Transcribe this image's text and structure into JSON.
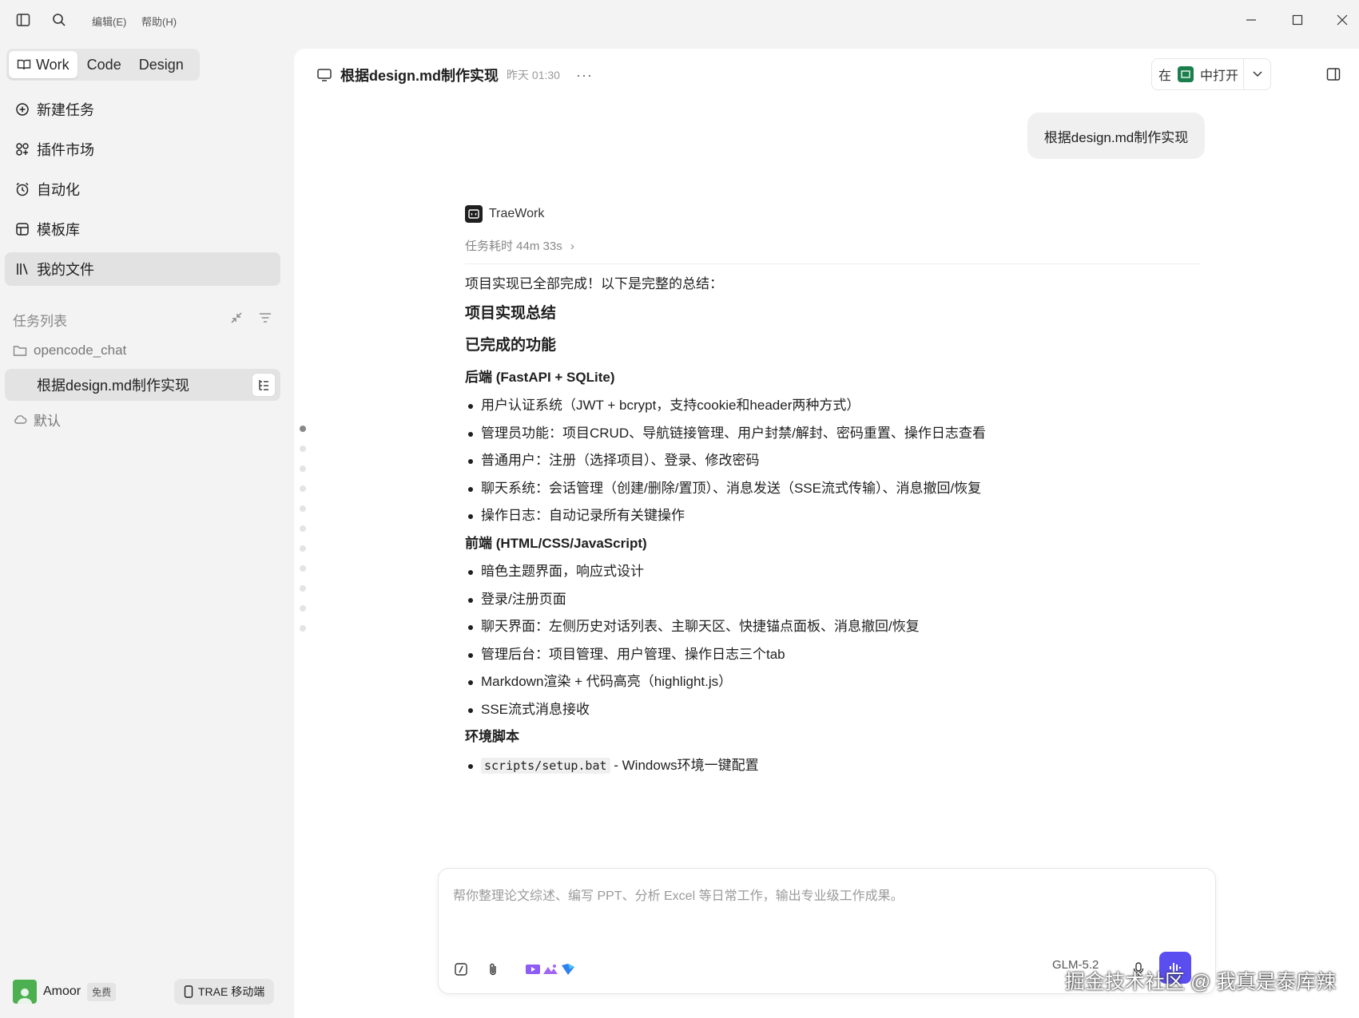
{
  "titlebar": {
    "menu_edit": "编辑(E)",
    "menu_help": "帮助(H)"
  },
  "sidebar": {
    "modes": [
      "Work",
      "Code",
      "Design"
    ],
    "active_mode": "Work",
    "nav": [
      {
        "label": "新建任务",
        "icon": "plus-circle-icon"
      },
      {
        "label": "插件市场",
        "icon": "plugin-grid-icon"
      },
      {
        "label": "自动化",
        "icon": "alarm-clock-icon"
      },
      {
        "label": "模板库",
        "icon": "template-icon"
      },
      {
        "label": "我的文件",
        "icon": "library-icon",
        "active": true
      }
    ],
    "task_section_title": "任务列表",
    "folder_name": "opencode_chat",
    "task_name": "根据design.md制作实现",
    "default_group": "默认",
    "user": {
      "name": "Amoor",
      "plan": "免费"
    },
    "mobile_label": "TRAE 移动端"
  },
  "header": {
    "title": "根据design.md制作实现",
    "timestamp": "昨天 01:30",
    "more": "···",
    "open_in_prefix": "在",
    "open_in_suffix": "中打开"
  },
  "conversation": {
    "user_message": "根据design.md制作实现",
    "agent_name": "TraeWork",
    "duration": "任务耗时 44m 33s",
    "intro": "项目实现已全部完成！以下是完整的总结：",
    "h_summary": "项目实现总结",
    "h_done": "已完成的功能",
    "backend_title": "后端 (FastAPI + SQLite)",
    "backend_items": [
      "用户认证系统（JWT + bcrypt，支持cookie和header两种方式）",
      "管理员功能：项目CRUD、导航链接管理、用户封禁/解封、密码重置、操作日志查看",
      "普通用户：注册（选择项目）、登录、修改密码",
      "聊天系统：会话管理（创建/删除/置顶）、消息发送（SSE流式传输）、消息撤回/恢复",
      "操作日志：自动记录所有关键操作"
    ],
    "frontend_title": "前端 (HTML/CSS/JavaScript)",
    "frontend_items": [
      "暗色主题界面，响应式设计",
      "登录/注册页面",
      "聊天界面：左侧历史对话列表、主聊天区、快捷锚点面板、消息撤回/恢复",
      "管理后台：项目管理、用户管理、操作日志三个tab",
      "Markdown渲染 + 代码高亮（highlight.js）",
      "SSE流式消息接收"
    ],
    "env_title": "环境脚本",
    "env_item_code": "scripts/setup.bat",
    "env_item_text": " - Windows环境一键配置"
  },
  "composer": {
    "placeholder": "帮你整理论文综述、编写 PPT、分析 Excel 等日常工作，输出专业级工作成果。",
    "model": "GLM-5.2"
  },
  "watermark": "掘金技术社区 @ 我真是泰库辣",
  "colors": {
    "accent": "#5b4ef0",
    "sidebar_bg": "#f3f3f3",
    "main_bg": "#ffffff"
  }
}
